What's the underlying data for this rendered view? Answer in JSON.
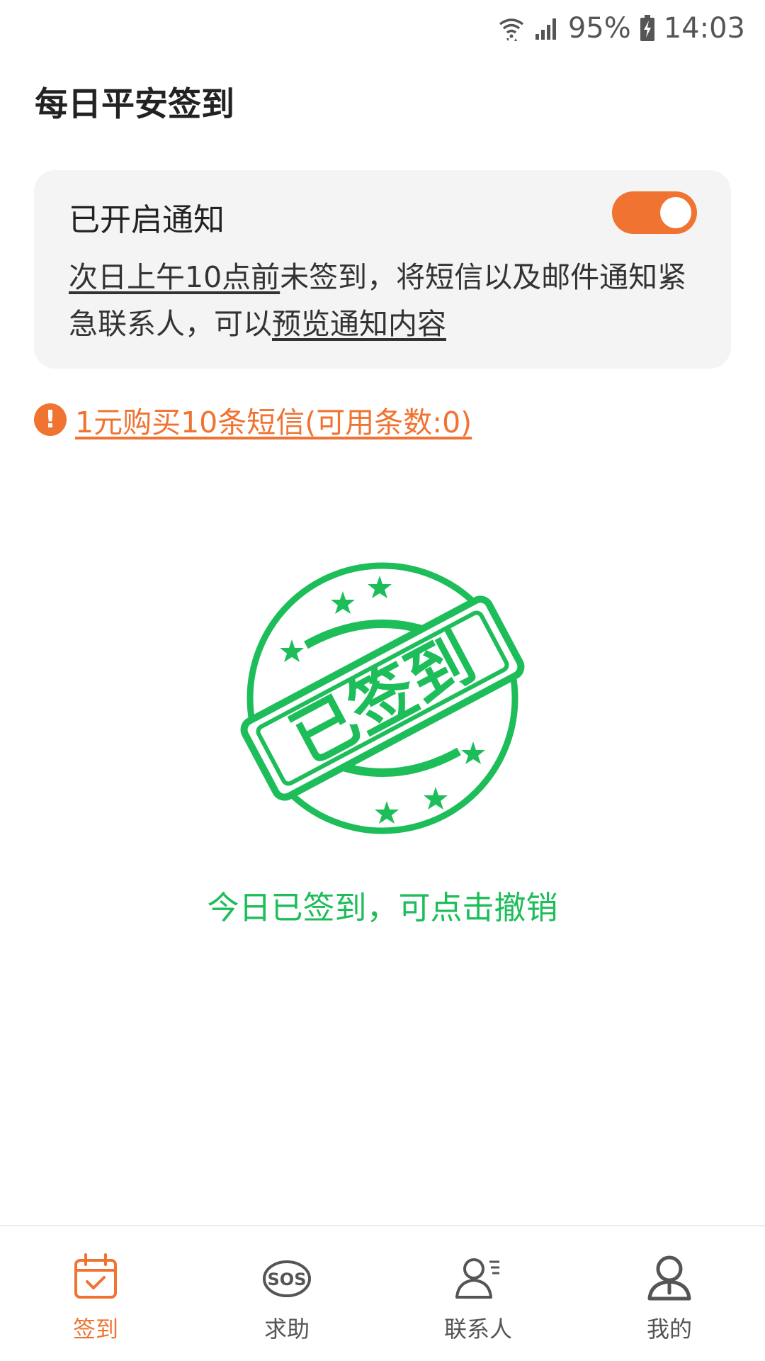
{
  "status_bar": {
    "battery": "95%",
    "time": "14:03"
  },
  "header": {
    "title": "每日平安签到"
  },
  "notice": {
    "title": "已开启通知",
    "toggle_on": true,
    "desc_link1": "次日上午10点前",
    "desc_mid": "未签到，将短信以及邮件通知紧急联系人，可以",
    "desc_link2": "预览通知内容"
  },
  "sms": {
    "link": "1元购买10条短信(可用条数:0)"
  },
  "stamp": {
    "text": "已签到",
    "color": "#1dbd5a"
  },
  "checkin_status": "今日已签到，可点击撤销",
  "nav": {
    "items": [
      {
        "label": "签到",
        "icon": "calendar-check-icon",
        "active": true
      },
      {
        "label": "求助",
        "icon": "sos-icon",
        "active": false
      },
      {
        "label": "联系人",
        "icon": "contacts-icon",
        "active": false
      },
      {
        "label": "我的",
        "icon": "person-icon",
        "active": false
      }
    ]
  },
  "colors": {
    "accent": "#f07331",
    "success": "#1dbd5a"
  }
}
